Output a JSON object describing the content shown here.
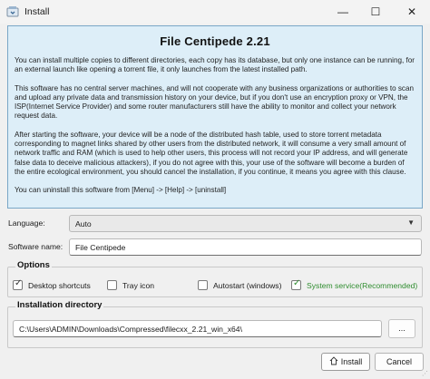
{
  "window": {
    "title": "Install",
    "minimize_glyph": "—",
    "maximize_glyph": "☐",
    "close_glyph": "✕"
  },
  "license": {
    "heading": "File Centipede 2.21",
    "paragraphs": [
      "You can install multiple copies to different directories, each copy has its database, but only one instance can be running, for an external launch like opening a torrent file, it only launches from the latest installed path.",
      "This software has no central server machines, and will not cooperate with any business organizations or authorities to scan and upload any private data and transmission history on your device, but if you don't use an encryption proxy or VPN, the ISP(Internet Service Provider) and some router manufacturers still have the ability to monitor and collect your network request data.",
      "After starting the software, your device will be a node of the distributed hash table, used to store torrent metadata corresponding to magnet links shared by other users from the distributed network, it will consume a very small amount of network traffic and RAM (which is used to help other users, this process will not record your IP address, and will generate false data to deceive malicious attackers), if you do not agree with this, your use of the software will become a burden of the entire ecological environment, you should cancel the installation, if you continue, it means you agree with this clause.",
      "You can uninstall this software from [Menu] -> [Help] -> [uninstall]"
    ]
  },
  "form": {
    "language_label": "Language:",
    "language_value": "Auto",
    "name_label": "Software name:",
    "name_value": "File Centipede"
  },
  "options": {
    "title": "Options",
    "items": [
      {
        "label": "Desktop shortcuts",
        "checked": true
      },
      {
        "label": "Tray icon",
        "checked": false
      },
      {
        "label": "Autostart (windows)",
        "checked": false
      },
      {
        "label": "System service(Recommended)",
        "checked": true
      }
    ]
  },
  "install_dir": {
    "title": "Installation directory",
    "path": "C:\\Users\\ADMIN\\Downloads\\Compressed\\filecxx_2.21_win_x64\\",
    "browse_label": "..."
  },
  "buttons": {
    "install_label": "Install",
    "cancel_label": "Cancel"
  },
  "colors": {
    "text_panel_bg": "#ddeef8",
    "recommended_green": "#2f8d2f"
  }
}
